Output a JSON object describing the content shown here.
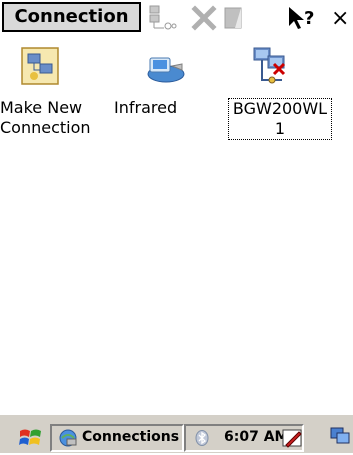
{
  "toolbar": {
    "title": "Connection",
    "icons": [
      "connection-properties-icon",
      "delete-icon",
      "view-icon",
      "help-icon",
      "close-icon"
    ],
    "help_glyph": "?",
    "close_glyph": "×"
  },
  "items": [
    {
      "name": "make-new-connection",
      "label": "Make New Connection",
      "icon": "new-connection-icon",
      "selected": false
    },
    {
      "name": "infrared",
      "label": "Infrared",
      "icon": "infrared-icon",
      "selected": false
    },
    {
      "name": "bgw200wl1",
      "label": "BGW200WL 1",
      "icon": "network-disconnected-icon",
      "selected": true
    }
  ],
  "taskbar": {
    "task_label": "Connections",
    "clock": "6:07 AM",
    "icons": [
      "start-flag-icon",
      "connections-icon",
      "bluetooth-icon",
      "pen-input-icon",
      "desktop-icon"
    ]
  },
  "colors": {
    "title_bg": "#d9d9d9",
    "taskbar_bg": "#d4d0c8",
    "close_red": "#cc0000"
  }
}
